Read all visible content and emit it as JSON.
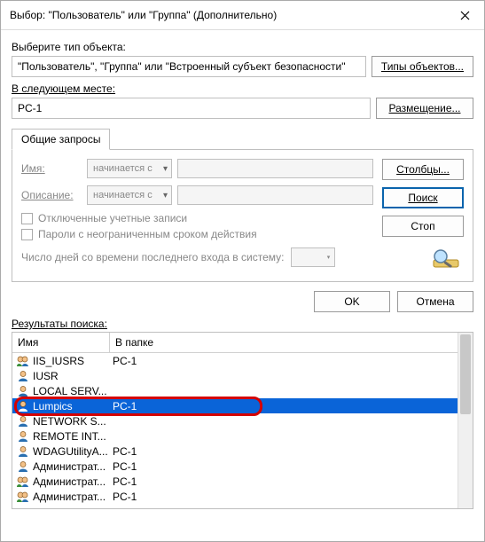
{
  "title": "Выбор: \"Пользователь\" или \"Группа\" (Дополнительно)",
  "labels": {
    "object_type": "Выберите тип объекта:",
    "object_value": "\"Пользователь\", \"Группа\" или \"Встроенный субъект безопасности\"",
    "types_btn": "Типы объектов...",
    "location_label_pre": "В следующем месте:",
    "location_value": "PC-1",
    "location_btn": "Размещение...",
    "tab": "Общие запросы",
    "name_label": "Имя:",
    "desc_label": "Описание:",
    "starts_with": "начинается с",
    "chk_disabled": "Отключенные учетные записи",
    "chk_noexpire": "Пароли с неограниченным сроком действия",
    "days_label": "Число дней со времени последнего входа в систему:",
    "columns_btn": "Столбцы...",
    "search_btn": "Поиск",
    "stop_btn": "Стоп",
    "ok": "OK",
    "cancel": "Отмена",
    "results_label": "Результаты поиска:",
    "col_name": "Имя",
    "col_folder": "В папке"
  },
  "results": [
    {
      "name": "IIS_IUSRS",
      "folder": "PC-1",
      "icon": "group",
      "sel": false
    },
    {
      "name": "IUSR",
      "folder": "",
      "icon": "user",
      "sel": false
    },
    {
      "name": "LOCAL SERV...",
      "folder": "",
      "icon": "user",
      "sel": false
    },
    {
      "name": "Lumpics",
      "folder": "PC-1",
      "icon": "user",
      "sel": true
    },
    {
      "name": "NETWORK S...",
      "folder": "",
      "icon": "user",
      "sel": false
    },
    {
      "name": "REMOTE INT...",
      "folder": "",
      "icon": "user",
      "sel": false
    },
    {
      "name": "WDAGUtilityA...",
      "folder": "PC-1",
      "icon": "user",
      "sel": false
    },
    {
      "name": "Администрат...",
      "folder": "PC-1",
      "icon": "user",
      "sel": false
    },
    {
      "name": "Администрат...",
      "folder": "PC-1",
      "icon": "group",
      "sel": false
    },
    {
      "name": "Администрат...",
      "folder": "PC-1",
      "icon": "group",
      "sel": false
    }
  ]
}
